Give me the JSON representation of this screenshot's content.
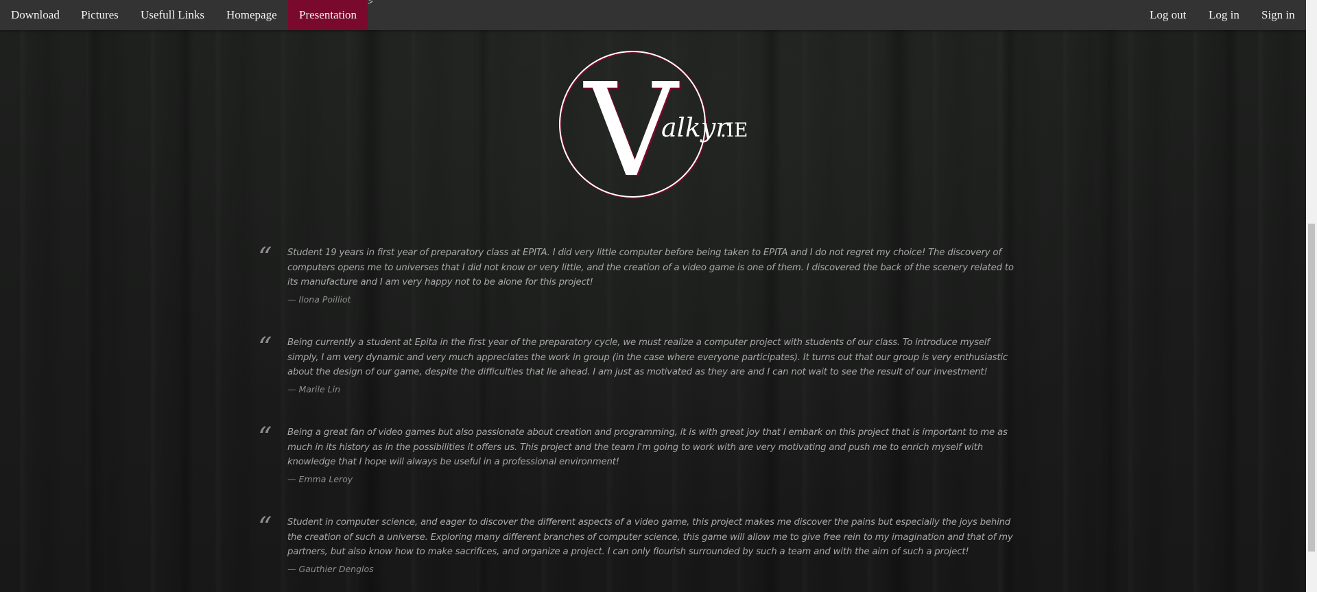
{
  "nav": {
    "items": [
      {
        "label": "Download"
      },
      {
        "label": "Pictures"
      },
      {
        "label": "Usefull Links"
      },
      {
        "label": "Homepage"
      },
      {
        "label": "Presentation",
        "active": true
      }
    ],
    "right_items": [
      {
        "label": "Log out"
      },
      {
        "label": "Log in"
      },
      {
        "label": "Sign in"
      }
    ],
    "stray_text": ">"
  },
  "logo": {
    "letter": "V",
    "script": "alkyr",
    "suffix": ".IE",
    "accent_color": "#7a0a2d"
  },
  "testimonials": [
    {
      "text": "Student 19 years in first year of preparatory class at EPITA. I did very little computer before being taken to EPITA and I do not regret my choice! The discovery of computers opens me to universes that I did not know or very little, and the creation of a video game is one of them. I discovered the back of the scenery related to its manufacture and I am very happy not to be alone for this project!",
      "author": "—  Ilona Poilliot"
    },
    {
      "text": "Being currently a student at Epita in the first year of the preparatory cycle, we must realize a computer project with students of our class. To introduce myself simply, I am very dynamic and very much appreciates the work in group (in the case where everyone participates). It turns out that our group is very enthusiastic about the design of our game, despite the difficulties that lie ahead. I am just as motivated as they are and I can not wait to see the result of our investment!",
      "author": "—  Marile Lin"
    },
    {
      "text": "Being a great fan of video games but also passionate about creation and programming, it is with great joy that I embark on this project that is important to me as much in its history as in the possibilities it offers us. This project and the team I'm going to work with are very motivating and push me to enrich myself with knowledge that I hope will always be useful in a professional environment!",
      "author": "—  Emma Leroy"
    },
    {
      "text": "Student in computer science, and eager to discover the different aspects of a video game, this project makes me discover the pains but especially the joys behind the creation of such a universe. Exploring many different branches of computer science, this game will allow me to give free rein to my imagination and that of my partners, but also know how to make sacrifices, and organize a project. I can only flourish surrounded by such a team and with the aim of such a project!",
      "author": "— Gauthier Denglos"
    }
  ],
  "quote_glyph": "“",
  "colors": {
    "navbar": "#333333",
    "active_tab": "#7a0a2d",
    "text": "#a7a7a7"
  }
}
